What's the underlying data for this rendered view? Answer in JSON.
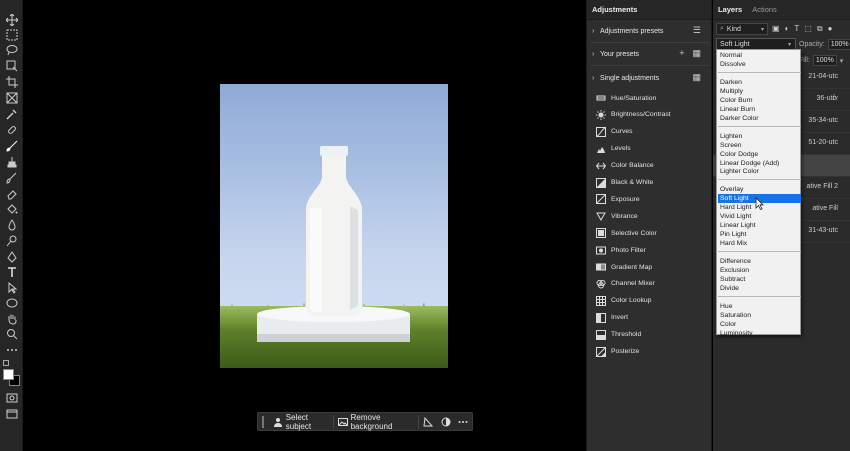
{
  "canvas": {
    "context_bar": {
      "select_subject": "Select subject",
      "remove_background": "Remove background"
    }
  },
  "adjustments": {
    "tab_title": "Adjustments",
    "sections": {
      "presets": "Adjustments presets",
      "your_presets": "Your presets",
      "single": "Single adjustments"
    },
    "items": [
      {
        "label": "Hue/Saturation",
        "icon": "hue-saturation-icon"
      },
      {
        "label": "Brightness/Contrast",
        "icon": "brightness-contrast-icon"
      },
      {
        "label": "Curves",
        "icon": "curves-icon"
      },
      {
        "label": "Levels",
        "icon": "levels-icon"
      },
      {
        "label": "Color Balance",
        "icon": "color-balance-icon"
      },
      {
        "label": "Black & White",
        "icon": "black-white-icon"
      },
      {
        "label": "Exposure",
        "icon": "exposure-icon"
      },
      {
        "label": "Vibrance",
        "icon": "vibrance-icon"
      },
      {
        "label": "Selective Color",
        "icon": "selective-color-icon"
      },
      {
        "label": "Photo Filter",
        "icon": "photo-filter-icon"
      },
      {
        "label": "Gradient Map",
        "icon": "gradient-map-icon"
      },
      {
        "label": "Channel Mixer",
        "icon": "channel-mixer-icon"
      },
      {
        "label": "Color Lookup",
        "icon": "color-lookup-icon"
      },
      {
        "label": "Invert",
        "icon": "invert-icon"
      },
      {
        "label": "Threshold",
        "icon": "threshold-icon"
      },
      {
        "label": "Posterize",
        "icon": "posterize-icon"
      }
    ]
  },
  "layers": {
    "tabs": [
      "Layers",
      "Actions"
    ],
    "kind_label": "Kind",
    "blend_mode": "Soft Light",
    "opacity_label": "Opacity:",
    "opacity_value": "100%",
    "fill_label": "Fill:",
    "fill_value": "100%",
    "rows": [
      {
        "label": "21-04-utc",
        "fx": ""
      },
      {
        "label": "36-utc",
        "fx": "fx"
      },
      {
        "label": "35-34-utc",
        "fx": ""
      },
      {
        "label": "51-20-utc",
        "fx": ""
      },
      {
        "label": "",
        "fx": ""
      },
      {
        "label": "ative Fill 2",
        "fx": ""
      },
      {
        "label": "ative Fill",
        "fx": ""
      },
      {
        "label": "31-43-utc",
        "fx": ""
      }
    ]
  },
  "blend_menu": {
    "groups": [
      [
        "Normal",
        "Dissolve"
      ],
      [
        "Darken",
        "Multiply",
        "Color Burn",
        "Linear Burn",
        "Darker Color"
      ],
      [
        "Lighten",
        "Screen",
        "Color Dodge",
        "Linear Dodge (Add)",
        "Lighter Color"
      ],
      [
        "Overlay",
        "Soft Light",
        "Hard Light",
        "Vivid Light",
        "Linear Light",
        "Pin Light",
        "Hard Mix"
      ],
      [
        "Difference",
        "Exclusion",
        "Subtract",
        "Divide"
      ],
      [
        "Hue",
        "Saturation",
        "Color",
        "Luminosity"
      ]
    ],
    "highlighted": "Soft Light"
  },
  "colors": {
    "highlight": "#1473e6",
    "panel_bg": "#2e2e2e"
  }
}
